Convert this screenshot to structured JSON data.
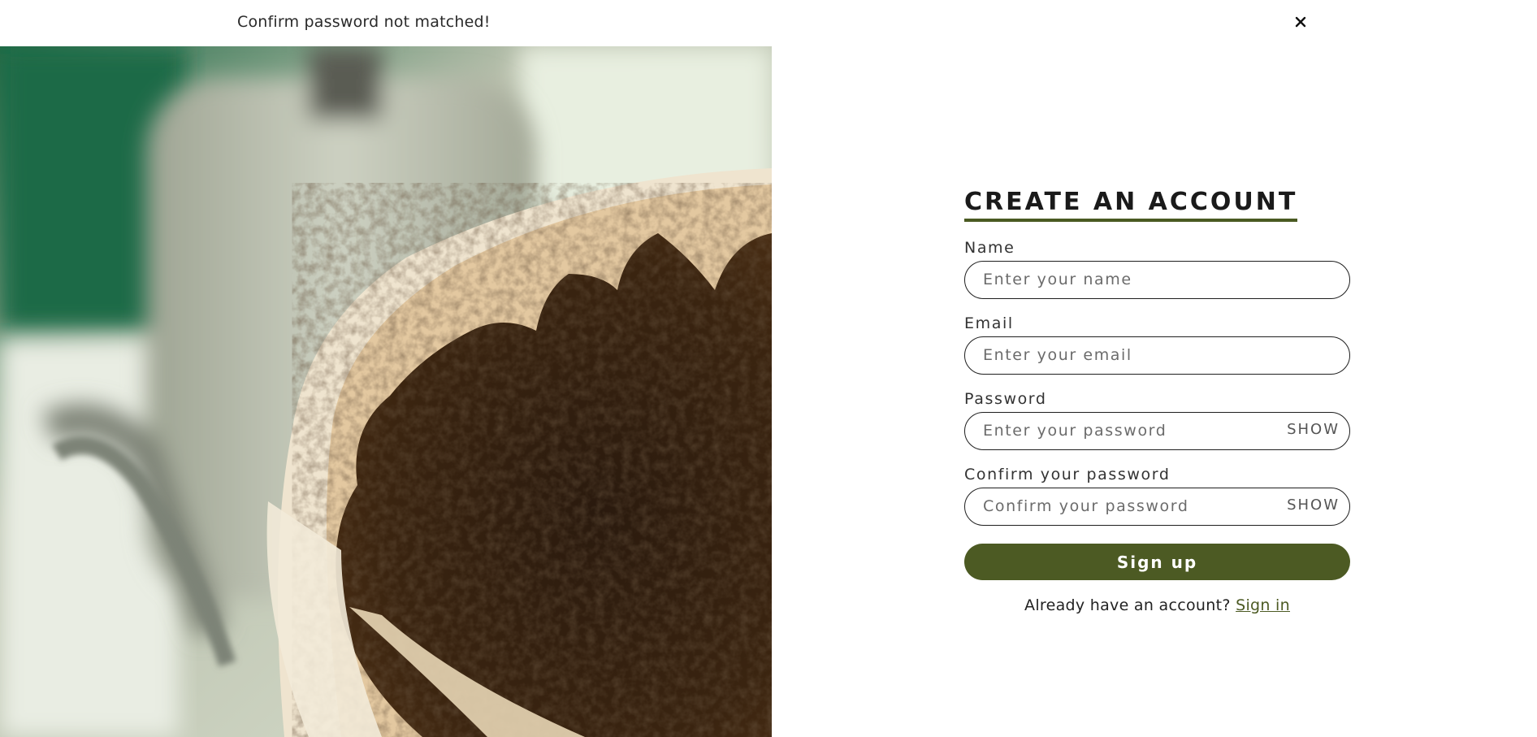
{
  "alert": {
    "message": "Confirm password not matched!",
    "close_icon": "close-icon"
  },
  "hero": {
    "image_subject": "coffee grounds in paper filter with gooseneck kettle"
  },
  "form": {
    "title": "CREATE AN ACCOUNT",
    "name": {
      "label": "Name",
      "placeholder": "Enter your name",
      "value": ""
    },
    "email": {
      "label": "Email",
      "placeholder": "Enter your email",
      "value": ""
    },
    "password": {
      "label": "Password",
      "placeholder": "Enter your password",
      "value": "",
      "toggle_label": "SHOW"
    },
    "confirm": {
      "label": "Confirm your password",
      "placeholder": "Confirm your password",
      "value": "",
      "toggle_label": "SHOW"
    },
    "submit_label": "Sign up",
    "signin_prompt": "Already have an account?",
    "signin_link": "Sign in"
  },
  "colors": {
    "accent": "#4c5a23",
    "text": "#1f1f1f",
    "background": "#ffffff"
  }
}
